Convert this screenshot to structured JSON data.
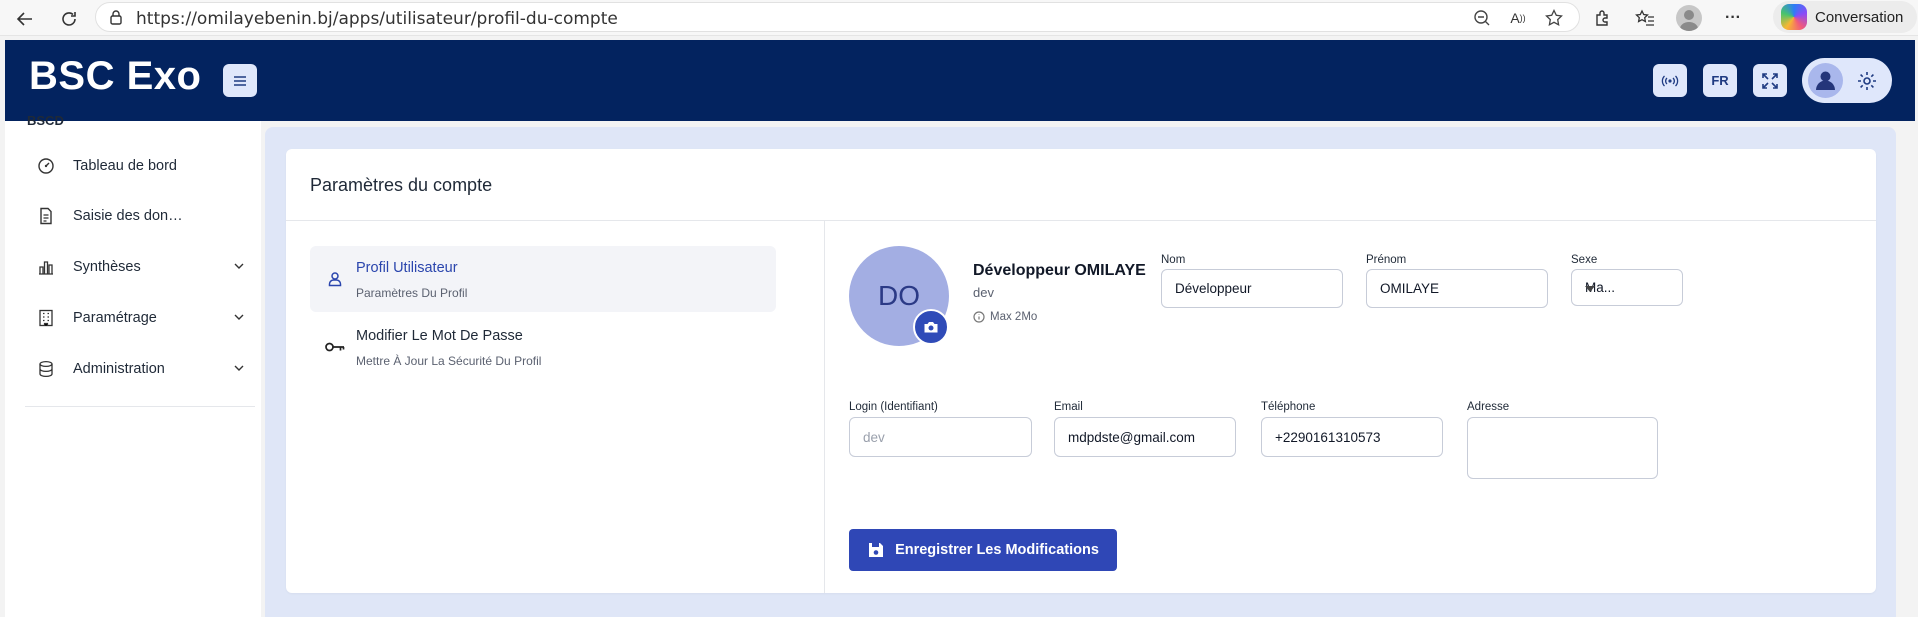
{
  "browser": {
    "url": "https://omilayebenin.bj/apps/utilisateur/profil-du-compte",
    "conversation_label": "Conversation"
  },
  "header": {
    "brand": "BSC Exo",
    "lang_button": "FR"
  },
  "sidebar": {
    "section_label": "BSCD",
    "items": [
      {
        "label": "Tableau de bord",
        "icon": "dashboard-icon",
        "has_chevron": false
      },
      {
        "label": "Saisie des don…",
        "icon": "document-icon",
        "has_chevron": false
      },
      {
        "label": "Synthèses",
        "icon": "bar-chart-icon",
        "has_chevron": true
      },
      {
        "label": "Paramétrage",
        "icon": "building-icon",
        "has_chevron": true
      },
      {
        "label": "Administration",
        "icon": "database-icon",
        "has_chevron": true
      }
    ]
  },
  "card": {
    "title": "Paramètres du compte",
    "tabs": [
      {
        "title": "Profil Utilisateur",
        "subtitle": "Paramètres Du Profil",
        "icon": "user-icon",
        "active": true
      },
      {
        "title": "Modifier Le Mot De Passe",
        "subtitle": "Mettre À Jour La Sécurité Du Profil",
        "icon": "key-icon",
        "active": false
      }
    ]
  },
  "profile": {
    "initials": "DO",
    "full_name": "Développeur OMILAYE",
    "login": "dev",
    "max_size": "Max 2Mo"
  },
  "form": {
    "nom": {
      "label": "Nom",
      "value": "Développeur"
    },
    "prenom": {
      "label": "Prénom",
      "value": "OMILAYE"
    },
    "sexe": {
      "label": "Sexe",
      "value": "Ma..."
    },
    "login": {
      "label": "Login (Identifiant)",
      "value": "dev"
    },
    "email": {
      "label": "Email",
      "value": "mdpdste@gmail.com"
    },
    "telephone": {
      "label": "Téléphone",
      "value": "+2290161310573"
    },
    "adresse": {
      "label": "Adresse",
      "value": ""
    },
    "save_label": "Enregistrer Les Modifications"
  },
  "colors": {
    "header_bg": "#03235f",
    "accent": "#2f47b6",
    "content_bg": "#dfe6f7",
    "avatar_bg": "#a3aee3"
  }
}
